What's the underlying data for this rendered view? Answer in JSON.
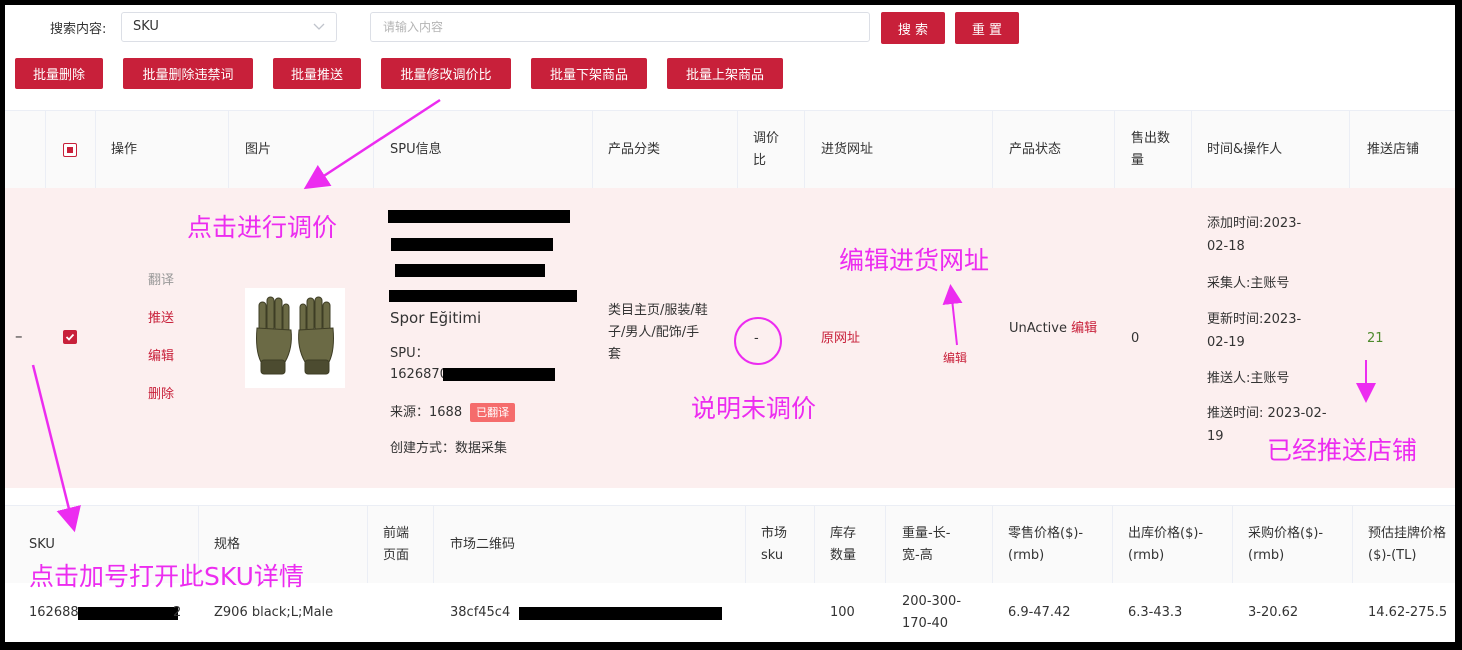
{
  "search": {
    "label": "搜索内容:",
    "field_value": "SKU",
    "placeholder": "请输入内容",
    "search_button": "搜 索",
    "reset_button": "重 置"
  },
  "toolbar": {
    "buttons": [
      "批量删除",
      "批量删除违禁词",
      "批量推送",
      "批量修改调价比",
      "批量下架商品",
      "批量上架商品"
    ]
  },
  "table": {
    "headers": {
      "action": "操作",
      "image": "图片",
      "spu": "SPU信息",
      "category": "产品分类",
      "ratio": "调价比",
      "source_url": "进货网址",
      "status": "产品状态",
      "sold": "售出数量",
      "time": "时间&操作人",
      "shop": "推送店铺"
    },
    "row": {
      "expand": "–",
      "actions": {
        "translate": "翻译",
        "push": "推送",
        "edit": "编辑",
        "delete": "删除"
      },
      "product_name": "Spor Eğitimi",
      "spu_label": "SPU：",
      "spu_value": "1626870",
      "source_label": "来源：",
      "source_value": "1688",
      "translated_badge": "已翻译",
      "create_label": "创建方式：",
      "create_value": "数据采集",
      "category": "类目主页/服装/鞋子/男人/配饰/手套",
      "ratio": "-",
      "source_url_link": "原网址",
      "source_url_edit": "编辑",
      "status_text": "UnActive",
      "status_edit": "编辑",
      "sold": "0",
      "added_time": "添加时间:2023-02-18",
      "collector": "采集人:主账号",
      "updated_time": "更新时间:2023-02-19",
      "pusher": "推送人:主账号",
      "push_time": "推送时间: 2023-02-19",
      "shop": "21"
    }
  },
  "sku_table": {
    "headers": {
      "sku": "SKU",
      "spec": "规格",
      "front_page": "前端页面",
      "market_qr": "市场二维码",
      "market_sku": "市场sku",
      "stock": "库存数量",
      "weight": "重量-长-宽-高",
      "retail_price": "零售价格($)-(rmb)",
      "outbound_price": "出库价格($)-(rmb)",
      "purchase_price": "采购价格($)-(rmb)",
      "list_price": "预估挂牌价格($)-(TL)"
    },
    "row": {
      "sku_prefix": "162688",
      "sku_suffix": "2",
      "spec": "Z906 black;L;Male",
      "market_qr_prefix": "38cf45c4",
      "stock": "100",
      "weight": "200-300-170-40",
      "retail_price": "6.9-47.42",
      "outbound_price": "6.3-43.3",
      "purchase_price": "3-20.62",
      "list_price": "14.62-275.5"
    }
  },
  "annotations": {
    "click_adjust": "点击进行调价",
    "edit_url": "编辑进货网址",
    "not_adjusted": "说明未调价",
    "pushed": "已经推送店铺",
    "open_sku": "点击加号打开此SKU详情"
  },
  "colors": {
    "primary": "#c8203a",
    "annotation": "#ec2cf0",
    "row_bg": "#fcefef",
    "shop_count": "#4d8a2c"
  }
}
